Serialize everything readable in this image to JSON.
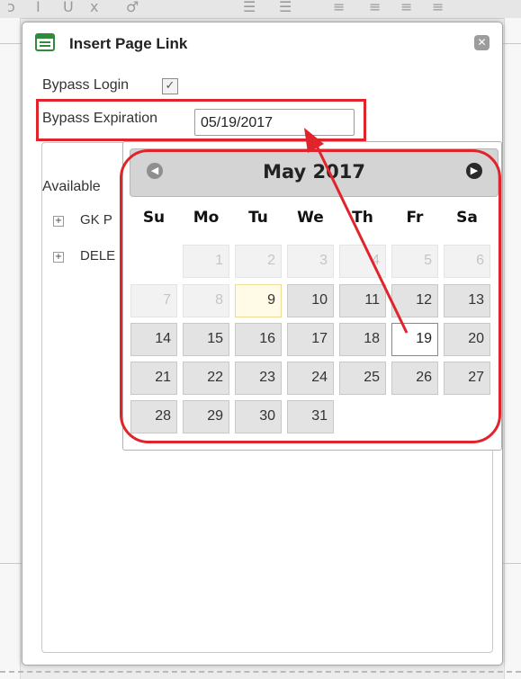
{
  "dialog": {
    "title": "Insert Page Link",
    "close_symbol": "✕",
    "bypass_login_label": "Bypass Login",
    "bypass_login_checked": true,
    "bypass_expiration_label": "Bypass Expiration",
    "bypass_expiration_value": "05/19/2017",
    "available_label": "Available",
    "tree_nodes": [
      "GK P",
      "DELE"
    ]
  },
  "calendar": {
    "month_title": "May 2017",
    "weekdays": [
      "Su",
      "Mo",
      "Tu",
      "We",
      "Th",
      "Fr",
      "Sa"
    ],
    "weeks": [
      [
        "",
        "1",
        "2",
        "3",
        "4",
        "5",
        "6"
      ],
      [
        "7",
        "8",
        "9",
        "10",
        "11",
        "12",
        "13"
      ],
      [
        "14",
        "15",
        "16",
        "17",
        "18",
        "19",
        "20"
      ],
      [
        "21",
        "22",
        "23",
        "24",
        "25",
        "26",
        "27"
      ],
      [
        "28",
        "29",
        "30",
        "31",
        "",
        "",
        ""
      ]
    ],
    "disabled_days": [
      "1",
      "2",
      "3",
      "4",
      "5",
      "6",
      "7",
      "8"
    ],
    "today": "9",
    "selected": "19",
    "prev_icon": "circle-left-arrow-icon",
    "next_icon": "circle-right-arrow-icon"
  },
  "colors": {
    "annotation_red": "#e0242c",
    "calendar_header": "#d4d4d4",
    "day_cell": "#e3e3e3"
  }
}
